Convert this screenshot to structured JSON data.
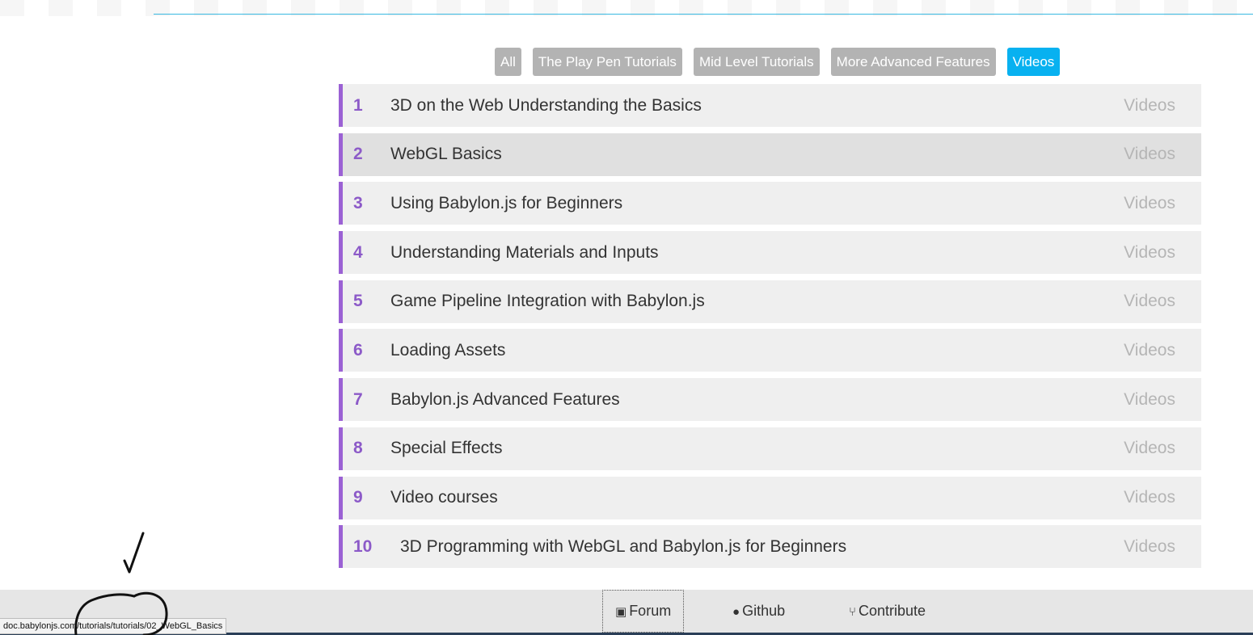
{
  "filters": [
    {
      "label": "All",
      "active": false
    },
    {
      "label": "The Play Pen Tutorials",
      "active": false
    },
    {
      "label": "Mid Level Tutorials",
      "active": false
    },
    {
      "label": "More Advanced Features",
      "active": false
    },
    {
      "label": "Videos",
      "active": true
    }
  ],
  "tutorials": [
    {
      "num": "1",
      "title": "3D on the Web Understanding the Basics",
      "category": "Videos"
    },
    {
      "num": "2",
      "title": "WebGL Basics",
      "category": "Videos"
    },
    {
      "num": "3",
      "title": "Using Babylon.js for Beginners",
      "category": "Videos"
    },
    {
      "num": "4",
      "title": "Understanding Materials and Inputs",
      "category": "Videos"
    },
    {
      "num": "5",
      "title": "Game Pipeline Integration with Babylon.js",
      "category": "Videos"
    },
    {
      "num": "6",
      "title": "Loading Assets",
      "category": "Videos"
    },
    {
      "num": "7",
      "title": "Babylon.js Advanced Features",
      "category": "Videos"
    },
    {
      "num": "8",
      "title": "Special Effects",
      "category": "Videos"
    },
    {
      "num": "9",
      "title": "Video courses",
      "category": "Videos"
    },
    {
      "num": "10",
      "title": "3D Programming with WebGL and Babylon.js for Beginners",
      "category": "Videos"
    }
  ],
  "footer": {
    "forum": "Forum",
    "github": "Github",
    "contribute": "Contribute"
  },
  "status_bar": {
    "url": "doc.babylonjs.com/tutorials/tutorials/02_WebGL_Basics"
  },
  "colors": {
    "accent_purple": "#9b61d4",
    "active_filter": "#08b1f0",
    "filter_gray": "#b3b3b3"
  }
}
